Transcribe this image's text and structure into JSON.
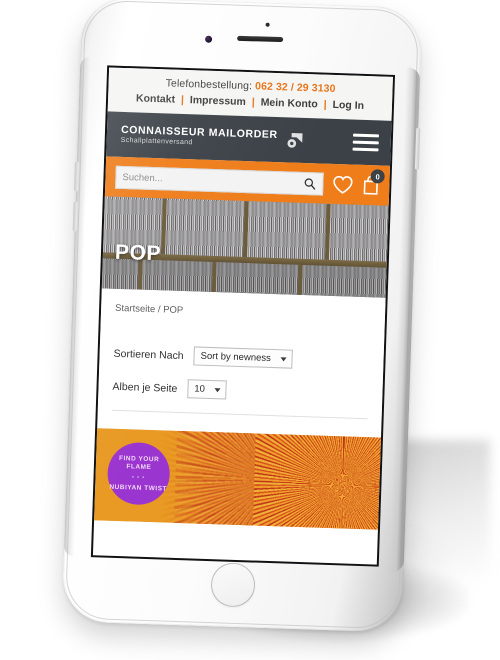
{
  "device": {
    "type": "white-smartphone",
    "orientation": "portrait"
  },
  "utility_bar": {
    "phone_label": "Telefonbestellung:",
    "phone_number": "062 32 / 29 3130",
    "links": [
      {
        "label": "Kontakt"
      },
      {
        "label": "Impressum"
      },
      {
        "label": "Mein Konto"
      },
      {
        "label": "Log In"
      }
    ],
    "separator": "|"
  },
  "masthead": {
    "brand_name": "CONNAISSEUR MAILORDER",
    "brand_subtitle": "Schallplattenversand",
    "logo_icon": "vinyl-record-mark",
    "menu_icon": "hamburger-menu-icon"
  },
  "search": {
    "placeholder": "Suchen...",
    "value": "",
    "search_icon": "search-icon",
    "wishlist_icon": "heart-icon",
    "cart_icon": "shopping-bag-icon",
    "cart_count": "0"
  },
  "hero": {
    "title": "POP",
    "image_alt": "record-shelf-photo"
  },
  "content": {
    "breadcrumb": "Startseite / POP",
    "sort": {
      "label": "Sortieren Nach",
      "selected": "Sort by newness",
      "chevron_icon": "chevron-down-icon"
    },
    "per_page": {
      "label": "Alben je Seite",
      "selected": "10",
      "chevron_icon": "chevron-down-icon"
    }
  },
  "promo": {
    "circle_line1": "FIND YOUR FLAME",
    "circle_divider": "• • •",
    "circle_line2": "NUBIYAN TWIST",
    "alt": "find-your-flame-nubiyan-twist-banner"
  },
  "colors": {
    "accent_orange": "#ef7d1a",
    "masthead_dark": "#3b4147",
    "promo_purple": "#9b35cf",
    "promo_orange": "#eb9a21",
    "utility_bg": "#f5f5f3"
  }
}
